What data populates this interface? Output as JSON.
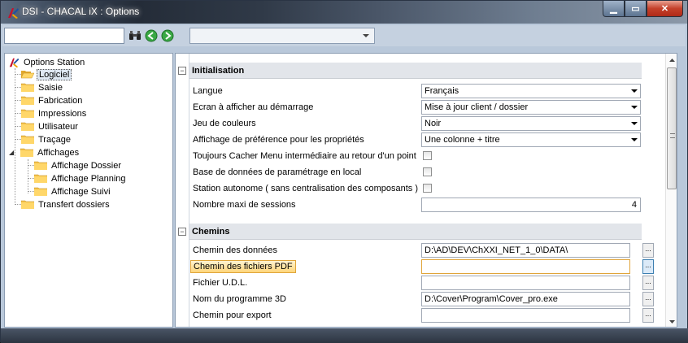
{
  "window": {
    "title": "DSI - CHACAL iX : Options"
  },
  "toolbar": {
    "search_value": "",
    "combo_value": ""
  },
  "tree": {
    "root": "Options Station",
    "items": [
      {
        "label": "Logiciel",
        "selected": true,
        "open": true
      },
      {
        "label": "Saisie"
      },
      {
        "label": "Fabrication"
      },
      {
        "label": "Impressions"
      },
      {
        "label": "Utilisateur"
      },
      {
        "label": "Traçage"
      },
      {
        "label": "Affichages",
        "expanded": true
      },
      {
        "label": "Affichage Dossier"
      },
      {
        "label": "Affichage Planning"
      },
      {
        "label": "Affichage Suivi"
      },
      {
        "label": "Transfert dossiers"
      }
    ]
  },
  "props": {
    "sections": [
      {
        "title": "Initialisation",
        "expanded": true
      },
      {
        "title": "Chemins",
        "expanded": true
      }
    ],
    "rows": [
      {
        "name": "Langue",
        "type": "dropdown",
        "value": "Français"
      },
      {
        "name": "Ecran à afficher au démarrage",
        "type": "dropdown",
        "value": "Mise à jour client / dossier"
      },
      {
        "name": "Jeu de couleurs",
        "type": "dropdown",
        "value": "Noir"
      },
      {
        "name": "Affichage de préférence pour les propriétés",
        "type": "dropdown",
        "value": "Une colonne + titre"
      },
      {
        "name": "Toujours Cacher Menu intermédiaire au retour d'un point",
        "type": "checkbox",
        "checked": false
      },
      {
        "name": "Base de données de paramétrage en local",
        "type": "checkbox",
        "checked": false
      },
      {
        "name": "Station autonome ( sans centralisation des composants )",
        "type": "checkbox",
        "checked": false
      },
      {
        "name": "Nombre maxi de sessions",
        "type": "number",
        "value": "4"
      },
      {
        "name": "Chemin des données",
        "type": "path",
        "value": "D:\\AD\\DEV\\ChXXI_NET_1_0\\DATA\\",
        "button": "..."
      },
      {
        "name": "Chemin des fichiers PDF",
        "type": "path",
        "value": "",
        "button": "...",
        "highlighted": true
      },
      {
        "name": "Fichier U.D.L.",
        "type": "path",
        "value": "",
        "button": "..."
      },
      {
        "name": "Nom du programme 3D",
        "type": "path",
        "value": "D:\\Cover\\Program\\Cover_pro.exe",
        "button": "..."
      },
      {
        "name": "Chemin pour export",
        "type": "path",
        "value": "",
        "button": "..."
      }
    ]
  },
  "colors": {
    "accent": "#3c7fb1",
    "highlight": "#ffd67a",
    "section_bg": "#e2e5ea"
  }
}
